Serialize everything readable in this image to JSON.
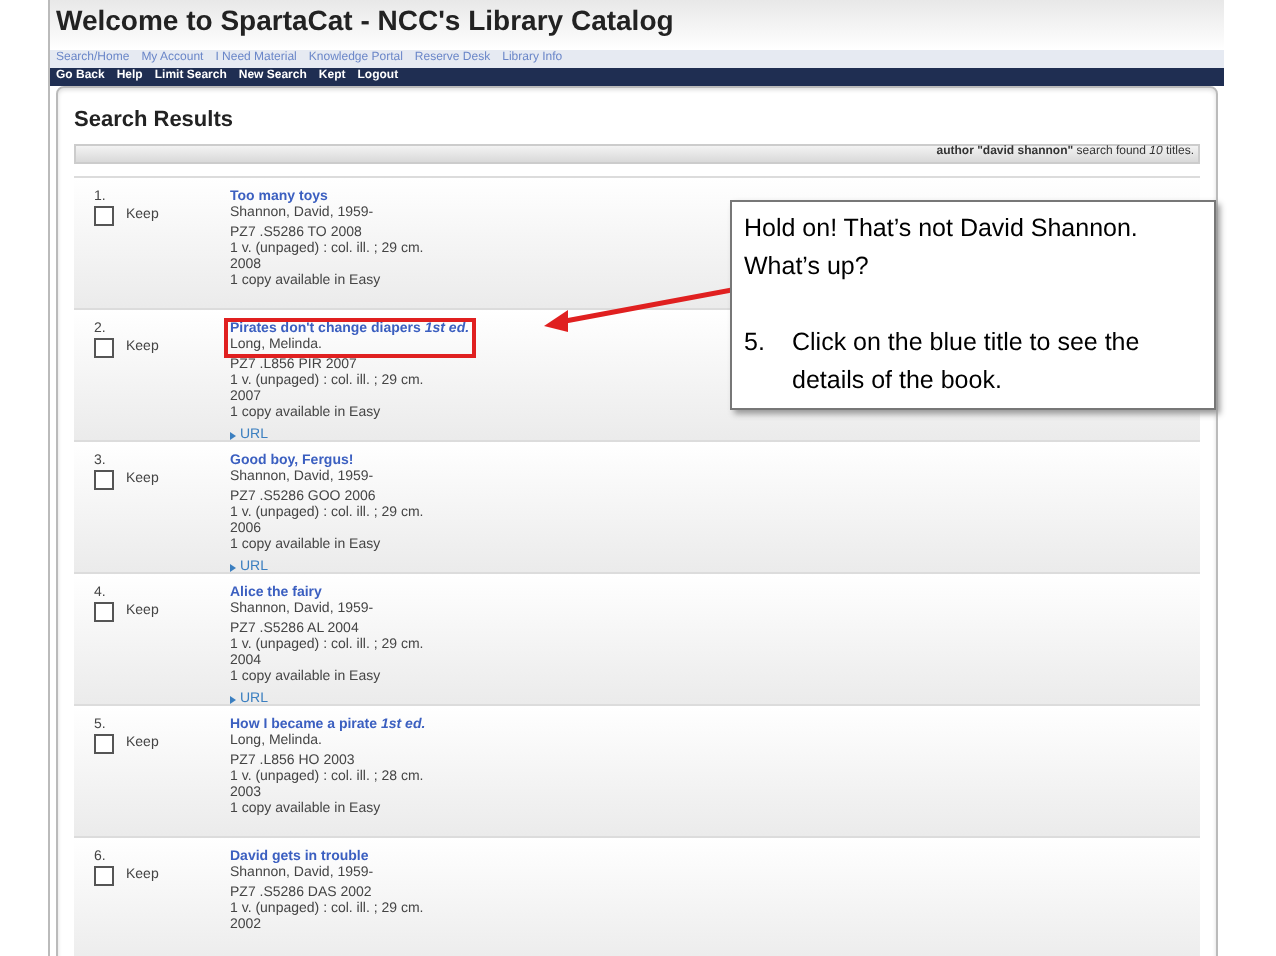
{
  "header": {
    "title": "Welcome to SpartaCat - NCC's Library Catalog"
  },
  "top_nav": [
    "Search/Home",
    "My Account",
    "I Need Material",
    "Knowledge Portal",
    "Reserve Desk",
    "Library Info"
  ],
  "action_bar": [
    "Go Back",
    "Help",
    "Limit Search",
    "New Search",
    "Kept",
    "Logout"
  ],
  "results": {
    "heading": "Search Results",
    "summary": "**author \"david shannon\"** search found *10* titles.",
    "items": [
      {
        "number": "1.",
        "keep_label": "Keep",
        "checked": false,
        "highlighted": false,
        "title": "Too many toys",
        "lines": [
          "Shannon, David, 1959-",
          "PZ7 .S5286 TO 2008",
          "1 v. (unpaged) : col. ill. ; 29 cm.",
          "2008",
          "1 copy available in Easy"
        ]
      },
      {
        "number": "2.",
        "keep_label": "Keep",
        "checked": false,
        "highlighted": true,
        "title": "Pirates don't change diapers *1st ed.*",
        "lines": [
          "Long, Melinda.",
          "PZ7 .L856 PIR 2007",
          "1 v. (unpaged) : col. ill. ; 29 cm.",
          "2007",
          "1 copy available in Easy"
        ],
        "link": "URL"
      },
      {
        "number": "3.",
        "keep_label": "Keep",
        "checked": false,
        "highlighted": false,
        "title": "Good boy, Fergus!",
        "lines": [
          "Shannon, David, 1959-",
          "PZ7 .S5286 GOO 2006",
          "1 v. (unpaged) : col. ill. ; 29 cm.",
          "2006",
          "1 copy available in Easy"
        ],
        "link": "URL"
      },
      {
        "number": "4.",
        "keep_label": "Keep",
        "checked": false,
        "highlighted": false,
        "title": "Alice the fairy",
        "lines": [
          "Shannon, David, 1959-",
          "PZ7 .S5286 AL 2004",
          "1 v. (unpaged) : col. ill. ; 29 cm.",
          "2004",
          "1 copy available in Easy"
        ],
        "link": "URL"
      },
      {
        "number": "5.",
        "keep_label": "Keep",
        "checked": false,
        "highlighted": false,
        "title": "How I became a pirate *1st ed.*",
        "lines": [
          "Long, Melinda.",
          "PZ7 .L856 HO 2003",
          "1 v. (unpaged) : col. ill. ; 28 cm.",
          "2003",
          "1 copy available in Easy"
        ]
      },
      {
        "number": "6.",
        "keep_label": "Keep",
        "checked": false,
        "highlighted": false,
        "title": "David gets in trouble",
        "lines": [
          "Shannon, David, 1959-",
          "PZ7 .S5286 DAS 2002",
          "1 v. (unpaged) : col. ill. ; 29 cm.",
          "2002"
        ]
      }
    ]
  },
  "callout": {
    "paragraphs": [
      "Hold on! That’s not David Shannon. What’s up?"
    ],
    "steps": [
      {
        "number": "5.",
        "text": "Click on the blue title to see the details of the book."
      }
    ]
  }
}
